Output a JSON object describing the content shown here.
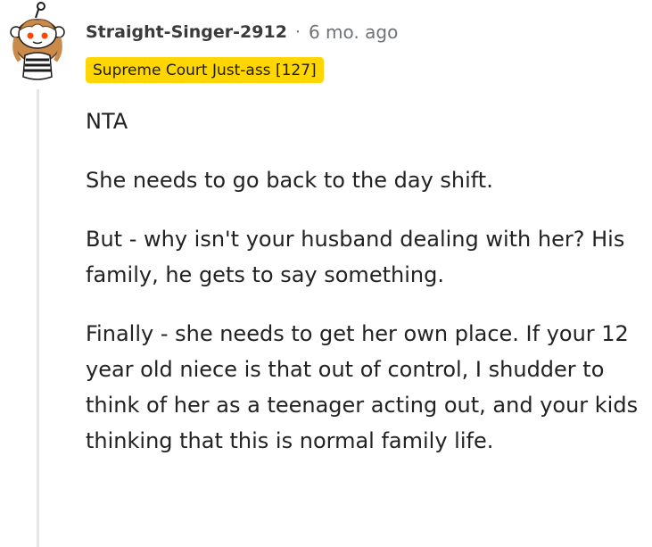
{
  "comment": {
    "username": "Straight-Singer-2912",
    "separator": "·",
    "time": "6 mo. ago",
    "flair": "Supreme Court Just-ass [127]",
    "paragraphs": [
      "NTA",
      "She needs to go back to the day shift.",
      "But - why isn't your husband dealing with her? His family, he gets to say something.",
      "Finally - she needs to get her own place. If your 12 year old niece is that out of control, I shudder to think of her as a teenager acting out, and your kids thinking that this is normal family life."
    ]
  },
  "colors": {
    "flair_bg": "#ffd600",
    "thread_line": "#e4e7ea",
    "meta_text": "#6f7377"
  }
}
